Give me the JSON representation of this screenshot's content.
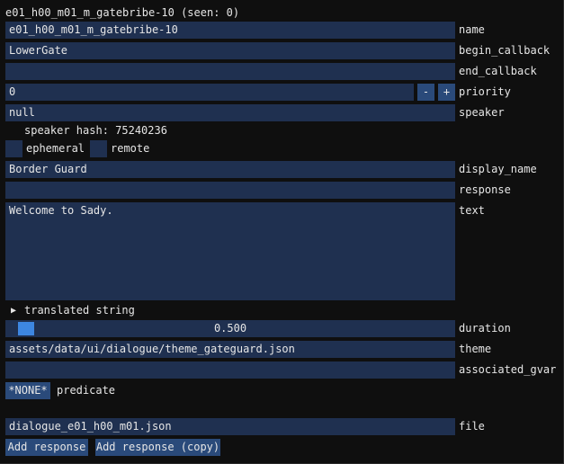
{
  "window_title": "e01_h00_m01_m_gatebribe-10 (seen: 0)",
  "fields": {
    "name": {
      "value": "e01_h00_m01_m_gatebribe-10",
      "label": "name"
    },
    "begin_callback": {
      "value": "LowerGate",
      "label": "begin_callback"
    },
    "end_callback": {
      "value": "",
      "label": "end_callback"
    },
    "priority": {
      "value": "0",
      "label": "priority",
      "minus": "-",
      "plus": "+"
    },
    "speaker": {
      "value": "null",
      "label": "speaker"
    },
    "display_name": {
      "value": "Border Guard",
      "label": "display_name"
    },
    "response": {
      "value": "",
      "label": "response"
    },
    "text": {
      "value": "Welcome to Sady.",
      "label": "text"
    },
    "duration": {
      "value": "0.500",
      "label": "duration",
      "fraction": 0.0
    },
    "theme": {
      "value": "assets/data/ui/dialogue/theme_gateguard.json",
      "label": "theme"
    },
    "associated_gvar": {
      "value": "",
      "label": "associated_gvar"
    },
    "file": {
      "value": "dialogue_e01_h00_m01.json",
      "label": "file"
    }
  },
  "speaker_hash": "speaker hash: 75240236",
  "checkboxes": {
    "ephemeral": {
      "label": "ephemeral",
      "checked": false
    },
    "remote": {
      "label": "remote",
      "checked": false
    }
  },
  "translated_string": {
    "arrow": "▶",
    "label": "translated string"
  },
  "predicate": {
    "button": "*NONE*",
    "label": "predicate"
  },
  "buttons": {
    "add_response": "Add response",
    "add_response_copy": "Add response (copy)"
  }
}
